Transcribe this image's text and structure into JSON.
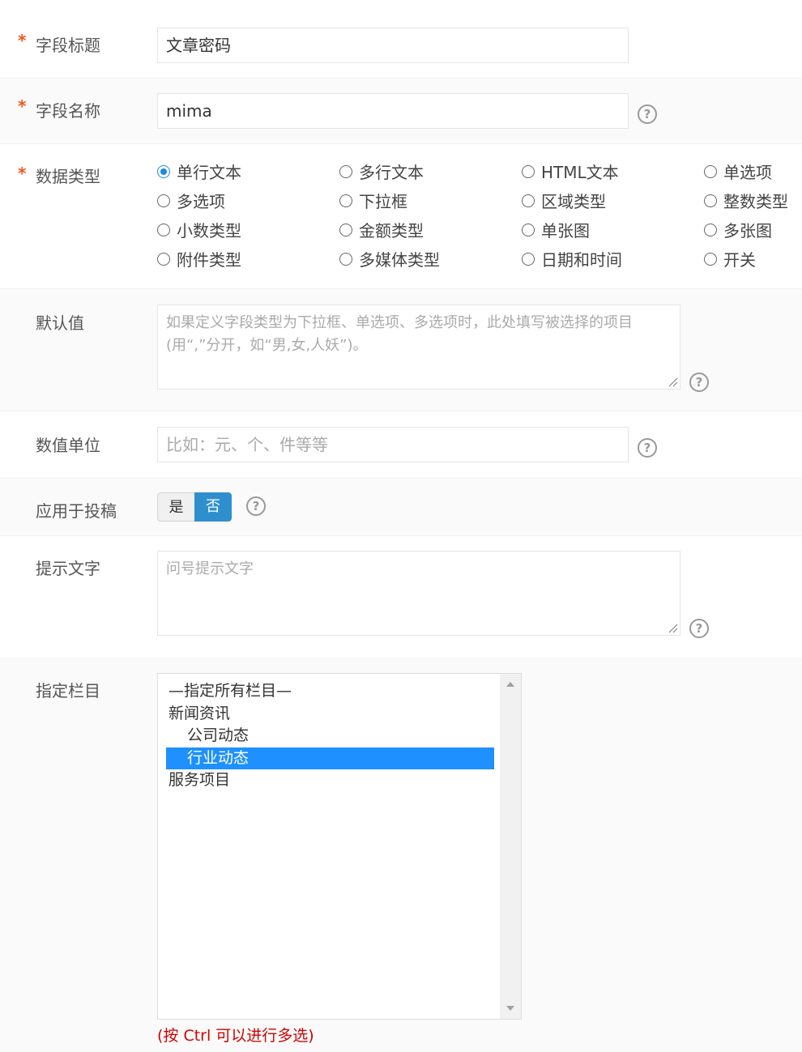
{
  "fields": {
    "title": {
      "label": "字段标题",
      "required_mark": "*",
      "value": "文章密码"
    },
    "name": {
      "label": "字段名称",
      "required_mark": "*",
      "value": "mima",
      "help_icon": "question-circle-icon"
    },
    "data_type": {
      "label": "数据类型",
      "required_mark": "*",
      "options": [
        "单行文本",
        "多行文本",
        "HTML文本",
        "单选项",
        "多选项",
        "下拉框",
        "区域类型",
        "整数类型",
        "小数类型",
        "金额类型",
        "单张图",
        "多张图",
        "附件类型",
        "多媒体类型",
        "日期和时间",
        "开关"
      ],
      "selected": "单行文本"
    },
    "default_value": {
      "label": "默认值",
      "placeholder": "如果定义字段类型为下拉框、单选项、多选项时，此处填写被选择的项目(用“,”分开，如“男,女,人妖”)。",
      "help_icon": "question-circle-icon"
    },
    "unit": {
      "label": "数值单位",
      "placeholder": "比如：元、个、件等等",
      "help_icon": "question-circle-icon"
    },
    "apply_to_submission": {
      "label": "应用于投稿",
      "yes_label": "是",
      "no_label": "否",
      "selected": "否",
      "help_icon": "question-circle-icon"
    },
    "hint_text": {
      "label": "提示文字",
      "placeholder": "问号提示文字",
      "help_icon": "question-circle-icon"
    },
    "category": {
      "label": "指定栏目",
      "items": [
        {
          "text": "—指定所有栏目—",
          "indent": false,
          "selected": false
        },
        {
          "text": "新闻资讯",
          "indent": false,
          "selected": false
        },
        {
          "text": "公司动态",
          "indent": true,
          "selected": false
        },
        {
          "text": "行业动态",
          "indent": true,
          "selected": true
        },
        {
          "text": "服务项目",
          "indent": false,
          "selected": false
        }
      ],
      "multi_select_hint": "(按 Ctrl 可以进行多选)"
    }
  },
  "colors": {
    "required": "#f0561f",
    "accent": "#2f8fce",
    "selection": "#1e90ff",
    "hint_red": "#d00000"
  }
}
